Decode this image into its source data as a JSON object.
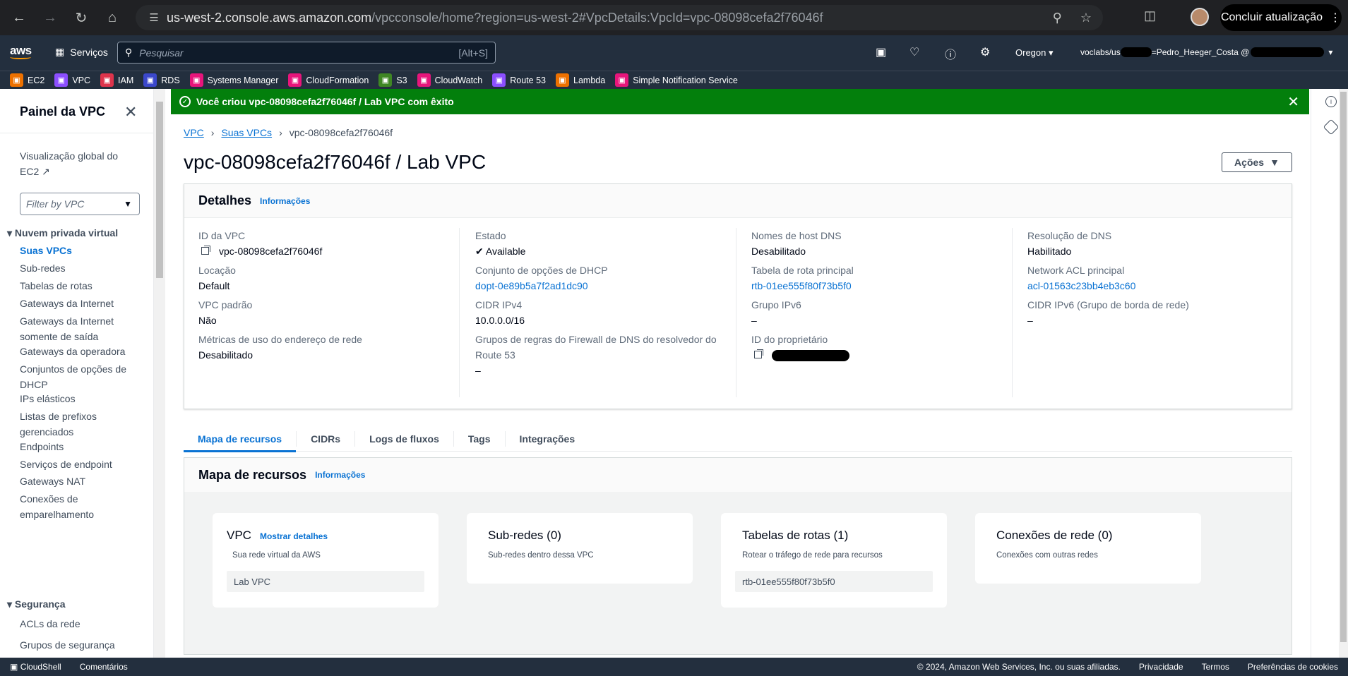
{
  "browser": {
    "url_host": "us-west-2.console.aws.amazon.com",
    "url_rest": "/vpcconsole/home?region=us-west-2#VpcDetails:VpcId=vpc-08098cefa2f76046f",
    "update_label": "Concluir atualização"
  },
  "aws": {
    "logo": "aws",
    "services_label": "Serviços",
    "search_placeholder": "Pesquisar",
    "search_shortcut": "[Alt+S]",
    "region": "Oregon",
    "account_prefix": "voclabs/us",
    "account_mid": "=Pedro_Heeger_Costa @"
  },
  "favorites": [
    {
      "label": "EC2",
      "color": "#ed7100",
      "icon": "ec2-icon"
    },
    {
      "label": "VPC",
      "color": "#8c4fff",
      "icon": "vpc-icon"
    },
    {
      "label": "IAM",
      "color": "#dd344c",
      "icon": "iam-icon"
    },
    {
      "label": "RDS",
      "color": "#3b48cc",
      "icon": "rds-icon"
    },
    {
      "label": "Systems Manager",
      "color": "#e7157b",
      "icon": "systems-manager-icon"
    },
    {
      "label": "CloudFormation",
      "color": "#e7157b",
      "icon": "cloudformation-icon"
    },
    {
      "label": "S3",
      "color": "#3f8624",
      "icon": "s3-icon"
    },
    {
      "label": "CloudWatch",
      "color": "#e7157b",
      "icon": "cloudwatch-icon"
    },
    {
      "label": "Route 53",
      "color": "#8c4fff",
      "icon": "route53-icon"
    },
    {
      "label": "Lambda",
      "color": "#ed7100",
      "icon": "lambda-icon"
    },
    {
      "label": "Simple Notification Service",
      "color": "#e7157b",
      "icon": "sns-icon"
    }
  ],
  "sidebar": {
    "title": "Painel da VPC",
    "global_view": "Visualização global do EC2",
    "filter_placeholder": "Filter by VPC",
    "section_vpc": "Nuvem privada virtual",
    "items": [
      "Suas VPCs",
      "Sub-redes",
      "Tabelas de rotas",
      "Gateways da Internet",
      "Gateways da Internet somente de saída",
      "Gateways da operadora",
      "Conjuntos de opções de DHCP",
      "IPs elásticos",
      "Listas de prefixos gerenciados",
      "Endpoints",
      "Serviços de endpoint",
      "Gateways NAT",
      "Conexões de emparelhamento"
    ],
    "section_security": "Segurança",
    "security_items": [
      "ACLs da rede",
      "Grupos de segurança"
    ]
  },
  "flash": {
    "message": "Você criou vpc-08098cefa2f76046f / Lab VPC com êxito"
  },
  "breadcrumb": [
    "VPC",
    "Suas VPCs",
    "vpc-08098cefa2f76046f"
  ],
  "page": {
    "title": "vpc-08098cefa2f76046f / Lab VPC",
    "actions": "Ações"
  },
  "details": {
    "title": "Detalhes",
    "info": "Informações",
    "col1": [
      {
        "label": "ID da VPC",
        "value": "vpc-08098cefa2f76046f"
      },
      {
        "label": "Locação",
        "value": "Default"
      },
      {
        "label": "VPC padrão",
        "value": "Não"
      },
      {
        "label": "Métricas de uso do endereço de rede",
        "value": "Desabilitado"
      }
    ],
    "col2": [
      {
        "label": "Estado",
        "value": "Available"
      },
      {
        "label": "Conjunto de opções de DHCP",
        "value": "dopt-0e89b5a7f2ad1dc90"
      },
      {
        "label": "CIDR IPv4",
        "value": "10.0.0.0/16"
      },
      {
        "label": "Grupos de regras do Firewall de DNS do resolvedor do Route 53",
        "value": "–"
      }
    ],
    "col3": [
      {
        "label": "Nomes de host DNS",
        "value": "Desabilitado"
      },
      {
        "label": "Tabela de rota principal",
        "value": "rtb-01ee555f80f73b5f0"
      },
      {
        "label": "Grupo IPv6",
        "value": "–"
      },
      {
        "label": "ID do proprietário",
        "value": ""
      }
    ],
    "col4": [
      {
        "label": "Resolução de DNS",
        "value": "Habilitado"
      },
      {
        "label": "Network ACL principal",
        "value": "acl-01563c23bb4eb3c60"
      },
      {
        "label": "CIDR IPv6 (Grupo de borda de rede)",
        "value": "–"
      }
    ]
  },
  "tabs": [
    "Mapa de recursos",
    "CIDRs",
    "Logs de fluxos",
    "Tags",
    "Integrações"
  ],
  "resource_map": {
    "title": "Mapa de recursos",
    "info": "Informações",
    "vpc": {
      "title": "VPC",
      "link": "Mostrar detalhes",
      "subtitle": "Sua rede virtual da AWS",
      "box": "Lab VPC"
    },
    "subnets": {
      "title": "Sub-redes (0)",
      "subtitle": "Sub-redes dentro dessa VPC"
    },
    "route_tables": {
      "title": "Tabelas de rotas (1)",
      "subtitle": "Rotear o tráfego de rede para recursos",
      "box": "rtb-01ee555f80f73b5f0"
    },
    "connections": {
      "title": "Conexões de rede (0)",
      "subtitle": "Conexões com outras redes"
    }
  },
  "footer": {
    "cloudshell": "CloudShell",
    "feedback": "Comentários",
    "copyright": "© 2024, Amazon Web Services, Inc. ou suas afiliadas.",
    "privacy": "Privacidade",
    "terms": "Termos",
    "cookies": "Preferências de cookies"
  }
}
